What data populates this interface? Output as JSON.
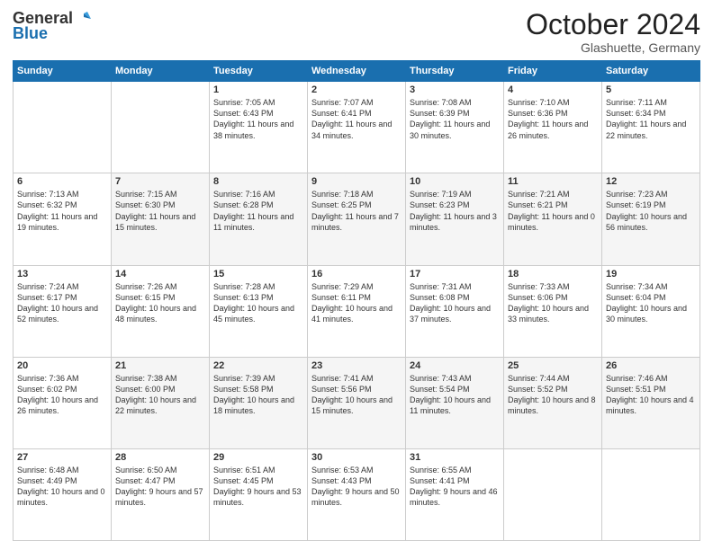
{
  "header": {
    "logo_line1": "General",
    "logo_line2": "Blue",
    "month": "October 2024",
    "location": "Glashuette, Germany"
  },
  "weekdays": [
    "Sunday",
    "Monday",
    "Tuesday",
    "Wednesday",
    "Thursday",
    "Friday",
    "Saturday"
  ],
  "rows": [
    [
      {
        "num": "",
        "sunrise": "",
        "sunset": "",
        "daylight": ""
      },
      {
        "num": "",
        "sunrise": "",
        "sunset": "",
        "daylight": ""
      },
      {
        "num": "1",
        "sunrise": "Sunrise: 7:05 AM",
        "sunset": "Sunset: 6:43 PM",
        "daylight": "Daylight: 11 hours and 38 minutes."
      },
      {
        "num": "2",
        "sunrise": "Sunrise: 7:07 AM",
        "sunset": "Sunset: 6:41 PM",
        "daylight": "Daylight: 11 hours and 34 minutes."
      },
      {
        "num": "3",
        "sunrise": "Sunrise: 7:08 AM",
        "sunset": "Sunset: 6:39 PM",
        "daylight": "Daylight: 11 hours and 30 minutes."
      },
      {
        "num": "4",
        "sunrise": "Sunrise: 7:10 AM",
        "sunset": "Sunset: 6:36 PM",
        "daylight": "Daylight: 11 hours and 26 minutes."
      },
      {
        "num": "5",
        "sunrise": "Sunrise: 7:11 AM",
        "sunset": "Sunset: 6:34 PM",
        "daylight": "Daylight: 11 hours and 22 minutes."
      }
    ],
    [
      {
        "num": "6",
        "sunrise": "Sunrise: 7:13 AM",
        "sunset": "Sunset: 6:32 PM",
        "daylight": "Daylight: 11 hours and 19 minutes."
      },
      {
        "num": "7",
        "sunrise": "Sunrise: 7:15 AM",
        "sunset": "Sunset: 6:30 PM",
        "daylight": "Daylight: 11 hours and 15 minutes."
      },
      {
        "num": "8",
        "sunrise": "Sunrise: 7:16 AM",
        "sunset": "Sunset: 6:28 PM",
        "daylight": "Daylight: 11 hours and 11 minutes."
      },
      {
        "num": "9",
        "sunrise": "Sunrise: 7:18 AM",
        "sunset": "Sunset: 6:25 PM",
        "daylight": "Daylight: 11 hours and 7 minutes."
      },
      {
        "num": "10",
        "sunrise": "Sunrise: 7:19 AM",
        "sunset": "Sunset: 6:23 PM",
        "daylight": "Daylight: 11 hours and 3 minutes."
      },
      {
        "num": "11",
        "sunrise": "Sunrise: 7:21 AM",
        "sunset": "Sunset: 6:21 PM",
        "daylight": "Daylight: 11 hours and 0 minutes."
      },
      {
        "num": "12",
        "sunrise": "Sunrise: 7:23 AM",
        "sunset": "Sunset: 6:19 PM",
        "daylight": "Daylight: 10 hours and 56 minutes."
      }
    ],
    [
      {
        "num": "13",
        "sunrise": "Sunrise: 7:24 AM",
        "sunset": "Sunset: 6:17 PM",
        "daylight": "Daylight: 10 hours and 52 minutes."
      },
      {
        "num": "14",
        "sunrise": "Sunrise: 7:26 AM",
        "sunset": "Sunset: 6:15 PM",
        "daylight": "Daylight: 10 hours and 48 minutes."
      },
      {
        "num": "15",
        "sunrise": "Sunrise: 7:28 AM",
        "sunset": "Sunset: 6:13 PM",
        "daylight": "Daylight: 10 hours and 45 minutes."
      },
      {
        "num": "16",
        "sunrise": "Sunrise: 7:29 AM",
        "sunset": "Sunset: 6:11 PM",
        "daylight": "Daylight: 10 hours and 41 minutes."
      },
      {
        "num": "17",
        "sunrise": "Sunrise: 7:31 AM",
        "sunset": "Sunset: 6:08 PM",
        "daylight": "Daylight: 10 hours and 37 minutes."
      },
      {
        "num": "18",
        "sunrise": "Sunrise: 7:33 AM",
        "sunset": "Sunset: 6:06 PM",
        "daylight": "Daylight: 10 hours and 33 minutes."
      },
      {
        "num": "19",
        "sunrise": "Sunrise: 7:34 AM",
        "sunset": "Sunset: 6:04 PM",
        "daylight": "Daylight: 10 hours and 30 minutes."
      }
    ],
    [
      {
        "num": "20",
        "sunrise": "Sunrise: 7:36 AM",
        "sunset": "Sunset: 6:02 PM",
        "daylight": "Daylight: 10 hours and 26 minutes."
      },
      {
        "num": "21",
        "sunrise": "Sunrise: 7:38 AM",
        "sunset": "Sunset: 6:00 PM",
        "daylight": "Daylight: 10 hours and 22 minutes."
      },
      {
        "num": "22",
        "sunrise": "Sunrise: 7:39 AM",
        "sunset": "Sunset: 5:58 PM",
        "daylight": "Daylight: 10 hours and 18 minutes."
      },
      {
        "num": "23",
        "sunrise": "Sunrise: 7:41 AM",
        "sunset": "Sunset: 5:56 PM",
        "daylight": "Daylight: 10 hours and 15 minutes."
      },
      {
        "num": "24",
        "sunrise": "Sunrise: 7:43 AM",
        "sunset": "Sunset: 5:54 PM",
        "daylight": "Daylight: 10 hours and 11 minutes."
      },
      {
        "num": "25",
        "sunrise": "Sunrise: 7:44 AM",
        "sunset": "Sunset: 5:52 PM",
        "daylight": "Daylight: 10 hours and 8 minutes."
      },
      {
        "num": "26",
        "sunrise": "Sunrise: 7:46 AM",
        "sunset": "Sunset: 5:51 PM",
        "daylight": "Daylight: 10 hours and 4 minutes."
      }
    ],
    [
      {
        "num": "27",
        "sunrise": "Sunrise: 6:48 AM",
        "sunset": "Sunset: 4:49 PM",
        "daylight": "Daylight: 10 hours and 0 minutes."
      },
      {
        "num": "28",
        "sunrise": "Sunrise: 6:50 AM",
        "sunset": "Sunset: 4:47 PM",
        "daylight": "Daylight: 9 hours and 57 minutes."
      },
      {
        "num": "29",
        "sunrise": "Sunrise: 6:51 AM",
        "sunset": "Sunset: 4:45 PM",
        "daylight": "Daylight: 9 hours and 53 minutes."
      },
      {
        "num": "30",
        "sunrise": "Sunrise: 6:53 AM",
        "sunset": "Sunset: 4:43 PM",
        "daylight": "Daylight: 9 hours and 50 minutes."
      },
      {
        "num": "31",
        "sunrise": "Sunrise: 6:55 AM",
        "sunset": "Sunset: 4:41 PM",
        "daylight": "Daylight: 9 hours and 46 minutes."
      },
      {
        "num": "",
        "sunrise": "",
        "sunset": "",
        "daylight": ""
      },
      {
        "num": "",
        "sunrise": "",
        "sunset": "",
        "daylight": ""
      }
    ]
  ]
}
